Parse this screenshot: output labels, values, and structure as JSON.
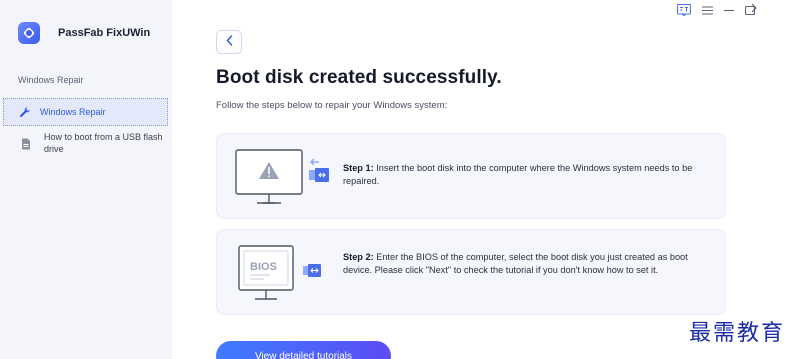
{
  "app": {
    "name": "PassFab FixUWin"
  },
  "sidebar": {
    "section_label": "Windows Repair",
    "items": [
      {
        "label": "Windows Repair",
        "icon": "wrench-icon",
        "active": true
      },
      {
        "label": "How to boot from a USB flash drive",
        "icon": "document-icon",
        "active": false
      }
    ]
  },
  "window_controls": {
    "icons": [
      "feedback-icon",
      "menu-icon",
      "minimize-icon",
      "maximize-icon",
      "chevron-right-icon"
    ]
  },
  "main": {
    "title": "Boot disk created successfully.",
    "subtitle": "Follow the steps below to repair your Windows system:",
    "steps": [
      {
        "label": "Step 1:",
        "text": " Insert the boot disk into the computer where the Windows system needs to be repaired."
      },
      {
        "label": "Step 2:",
        "text": " Enter the BIOS of the computer, select the boot disk you just created as boot device. Please click \"Next\" to check the tutorial if you don't know how to set it."
      }
    ],
    "illustration_bios_text": "BIOS",
    "cta_label": "View detailed tutorials"
  },
  "watermark": "最需教育",
  "colors": {
    "accent": "#3358e8",
    "sidebar_bg": "#f3f5fb",
    "card_bg": "#f5f7fc",
    "cta_start": "#3f7bff",
    "cta_end": "#5b4cf2",
    "watermark": "#1b2ba8"
  }
}
